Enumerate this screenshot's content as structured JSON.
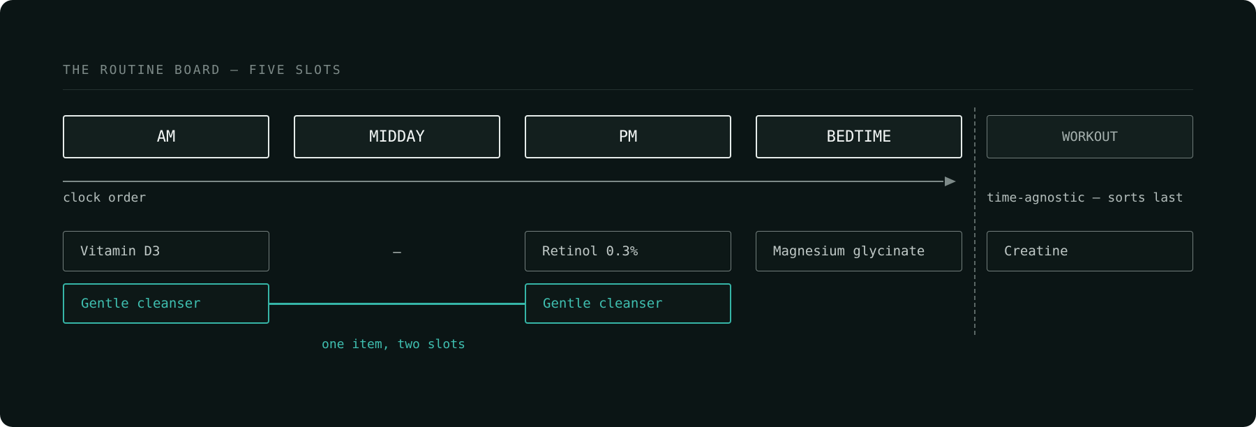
{
  "title": "THE ROUTINE BOARD — FIVE SLOTS",
  "slots": {
    "am": "AM",
    "midday": "MIDDAY",
    "pm": "PM",
    "bedtime": "BEDTIME",
    "workout": "WORKOUT"
  },
  "notes": {
    "clock_order": "clock order",
    "time_agnostic": "time-agnostic — sorts last",
    "shared_item": "one item, two slots"
  },
  "items": {
    "am": [
      "Vitamin D3",
      "Gentle cleanser"
    ],
    "midday_empty": "—",
    "pm": [
      "Retinol 0.3%",
      "Gentle cleanser"
    ],
    "bedtime": [
      "Magnesium glycinate"
    ],
    "workout": [
      "Creatine"
    ]
  },
  "colors": {
    "background": "#0b1515",
    "accent": "#36b5a7",
    "header_border": "#e6ecea",
    "muted_border": "#737f7d"
  }
}
